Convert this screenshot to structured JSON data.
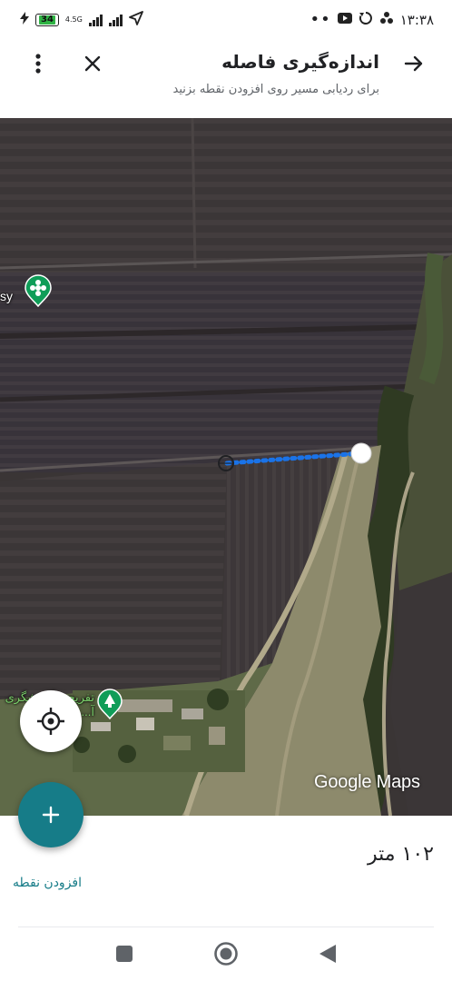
{
  "status_bar": {
    "time": "۱۳:۳۸",
    "battery": "34",
    "network": "4.5G",
    "dots": "••"
  },
  "app_bar": {
    "title": "اندازه‌گیری فاصله",
    "subtitle": "برای ردیابی مسیر روی افزودن نقطه بزنید"
  },
  "map": {
    "poi_left_label": "sy",
    "poi_bottom_label": "تفریحی گردشگری آ...",
    "attribution": "Google Maps",
    "measure_line_color": "#1a73e8"
  },
  "panel": {
    "distance": "۱۰۲ متر",
    "add_point_label": "افزودن نقطه"
  },
  "colors": {
    "accent": "#167c88",
    "poi_green": "#0f9d58"
  }
}
